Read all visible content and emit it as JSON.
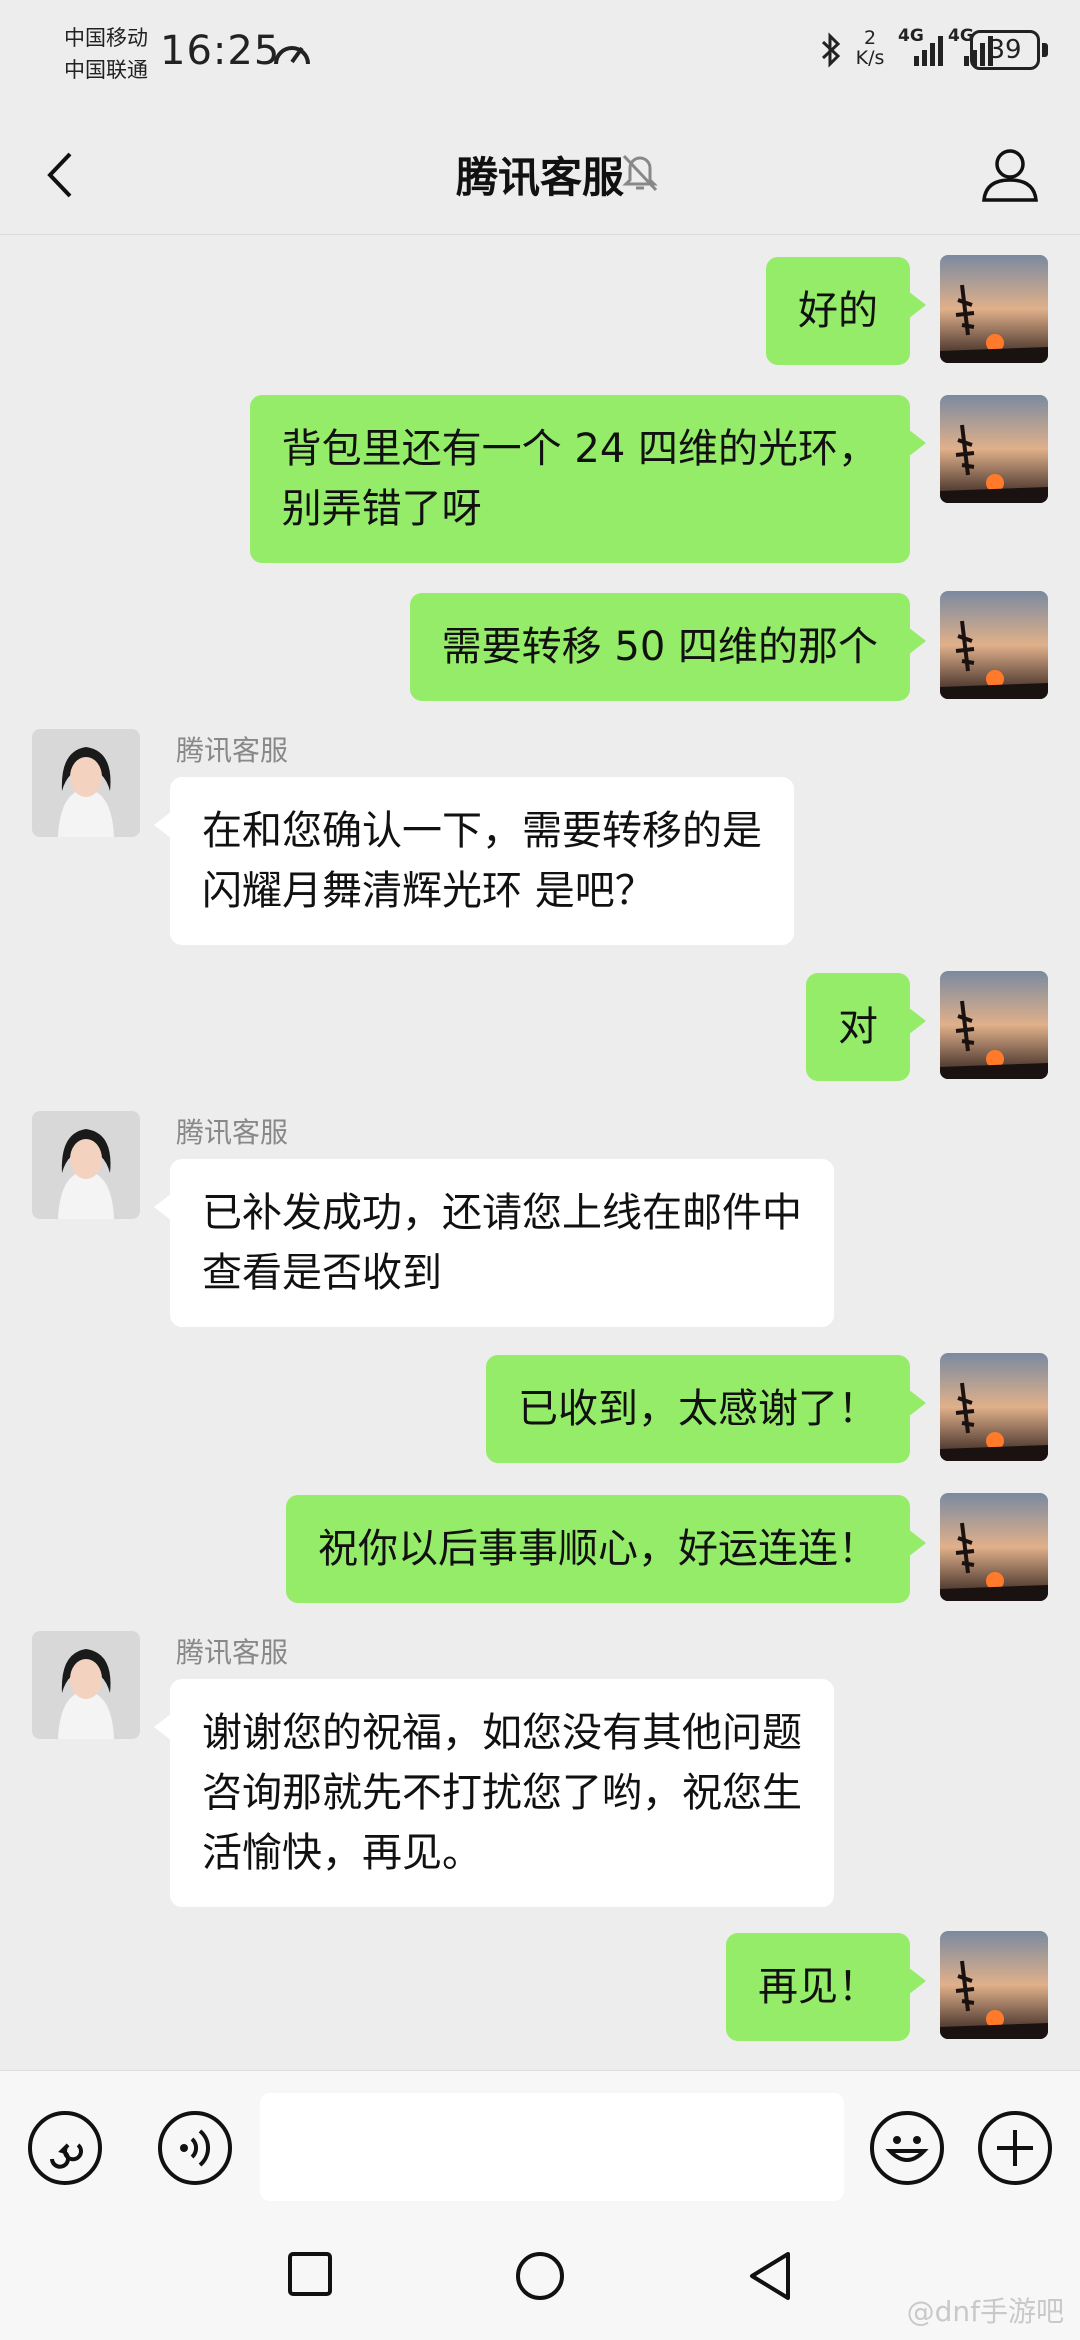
{
  "status_bar": {
    "carrier_1": "中国移动",
    "carrier_2": "中国联通",
    "time": "16:25",
    "net_speed_value": "2",
    "net_speed_unit": "K/s",
    "signal_1": "4G",
    "signal_2": "4G",
    "battery": "39"
  },
  "header": {
    "title": "腾讯客服"
  },
  "messages": [
    {
      "from": "me",
      "text": "好的"
    },
    {
      "from": "me",
      "lines": [
        "背包里还有一个 24 四维的光环，",
        "别弄错了呀"
      ]
    },
    {
      "from": "me",
      "text": "需要转移 50 四维的那个"
    },
    {
      "from": "them",
      "sender": "腾讯客服",
      "lines": [
        "在和您确认一下，需要转移的是",
        "闪耀月舞清辉光环  是吧？"
      ]
    },
    {
      "from": "me",
      "text": "对"
    },
    {
      "from": "them",
      "sender": "腾讯客服",
      "lines": [
        "已补发成功，还请您上线在邮件中",
        "查看是否收到"
      ]
    },
    {
      "from": "me",
      "text": "已收到，太感谢了！"
    },
    {
      "from": "me",
      "text": "祝你以后事事顺心，好运连连！"
    },
    {
      "from": "them",
      "sender": "腾讯客服",
      "lines": [
        "谢谢您的祝福，如您没有其他问题",
        "咨询那就先不打扰您了哟，祝您生",
        "活愉快，再见。"
      ]
    },
    {
      "from": "me",
      "text": "再见！"
    }
  ],
  "input_bar": {
    "placeholder": ""
  },
  "watermark": "@dnf手游吧",
  "colors": {
    "background": "#ededed",
    "my_bubble": "#95ec69",
    "their_bubble": "#ffffff",
    "sender_name": "#888888"
  },
  "icons": {
    "back": "chevron-left-icon",
    "mute": "bell-off-icon",
    "profile": "person-icon",
    "mini_program": "link-icon",
    "voice": "voice-icon",
    "emoji": "emoji-icon",
    "plus": "plus-icon",
    "nav_recent": "square-icon",
    "nav_home": "circle-icon",
    "nav_back": "triangle-back-icon"
  }
}
